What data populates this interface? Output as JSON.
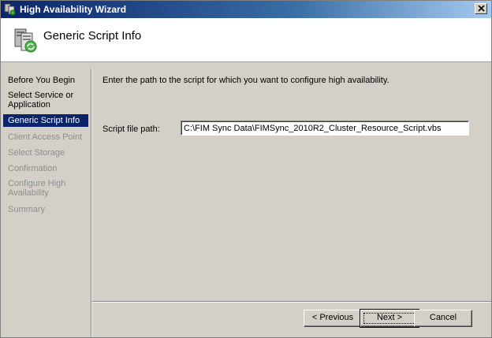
{
  "window": {
    "title": "High Availability Wizard",
    "close_symbol": "✕"
  },
  "header": {
    "title": "Generic Script Info",
    "icon": "cluster-wizard-icon"
  },
  "sidebar": {
    "items": [
      {
        "label": "Before You Begin",
        "state": "enabled"
      },
      {
        "label": "Select Service or Application",
        "state": "enabled"
      },
      {
        "label": "Generic Script Info",
        "state": "selected"
      },
      {
        "label": "Client Access Point",
        "state": "disabled"
      },
      {
        "label": "Select Storage",
        "state": "disabled"
      },
      {
        "label": "Confirmation",
        "state": "disabled"
      },
      {
        "label": "Configure High Availability",
        "state": "disabled"
      },
      {
        "label": "Summary",
        "state": "disabled"
      }
    ]
  },
  "main": {
    "instruction": "Enter the path to the script for which you want to configure high availability.",
    "path_label": "Script file path:",
    "path_value": "C:\\FIM Sync Data\\FIMSync_2010R2_Cluster_Resource_Script.vbs"
  },
  "buttons": {
    "previous": "< Previous",
    "next": "Next >",
    "cancel": "Cancel"
  },
  "colors": {
    "selection": "#0a246a",
    "disabled_text": "#8e8e8e",
    "dialog_face": "#d4d0c8"
  }
}
